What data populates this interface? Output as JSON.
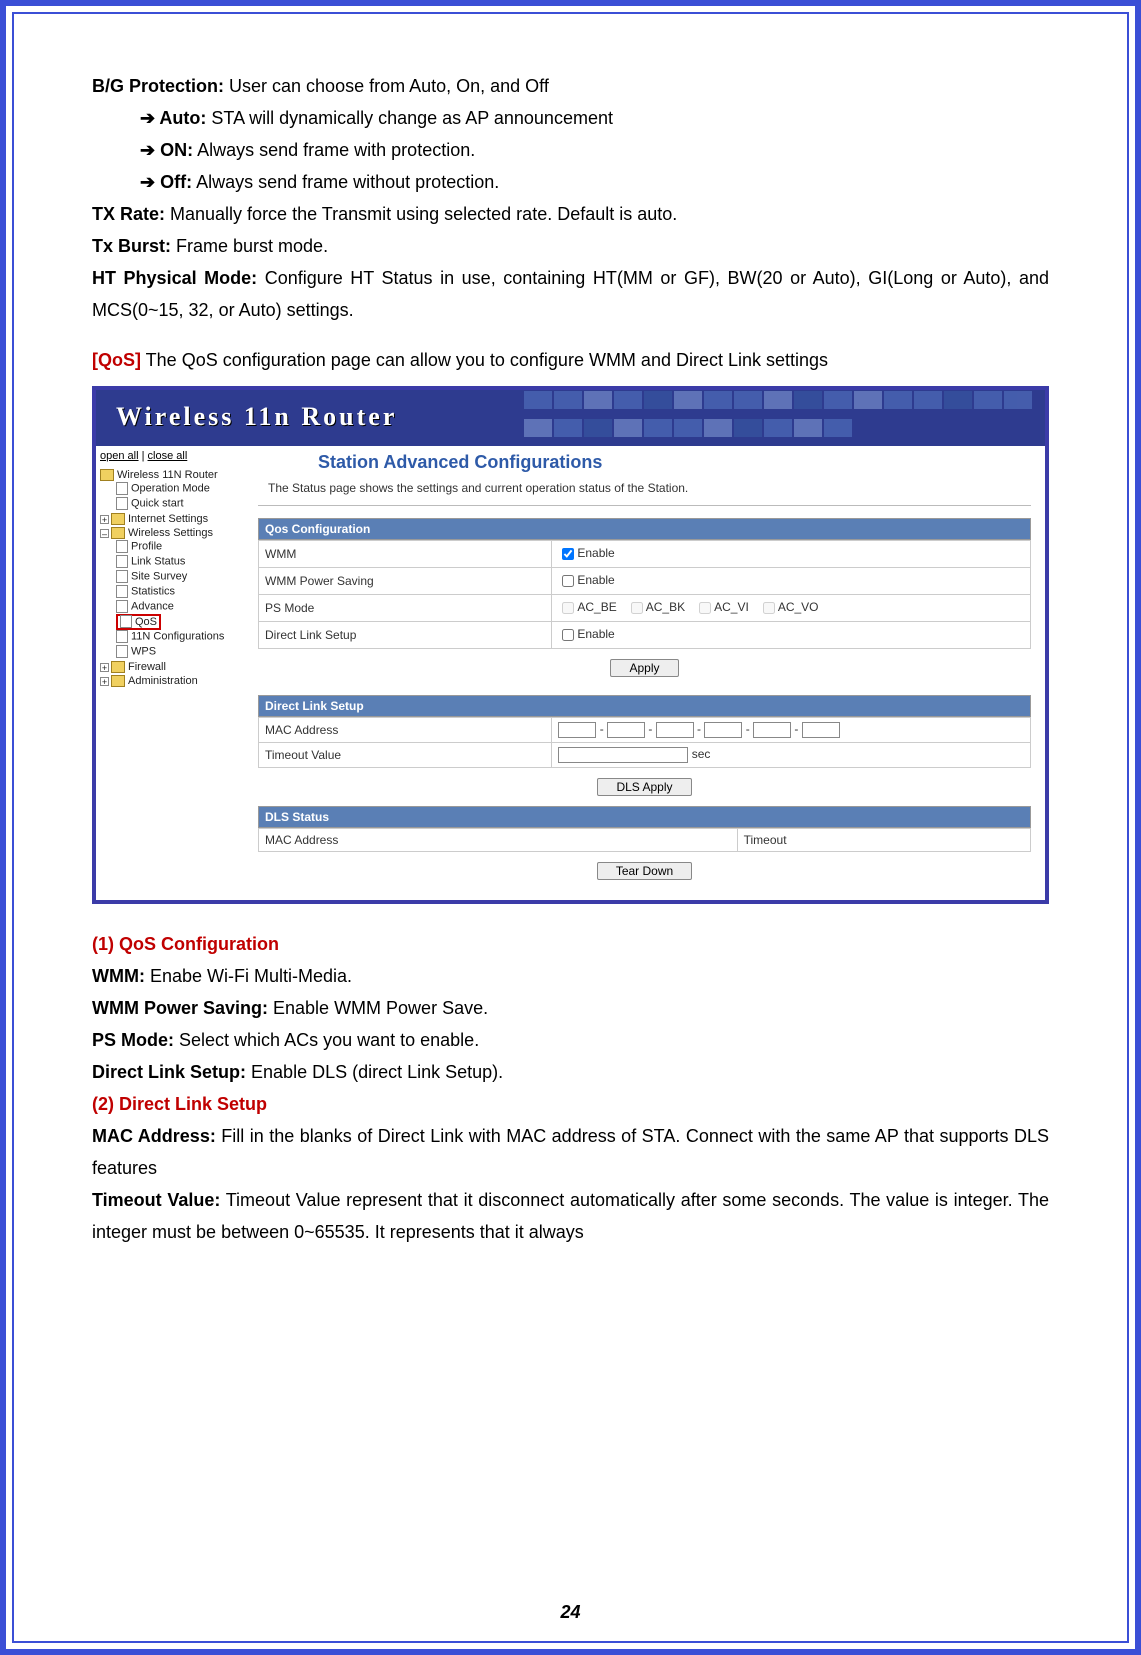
{
  "doc": {
    "bg_protection_label": "B/G Protection:",
    "bg_protection_text": " User can choose from Auto, On, and Off",
    "arrow": "➔",
    "auto_label": " Auto:",
    "auto_text": " STA will dynamically change as AP announcement",
    "on_label": " ON:",
    "on_text": " Always send frame with protection.",
    "off_label": " Off:",
    "off_text": " Always send frame without protection.",
    "txrate_label": "TX Rate:",
    "txrate_text": " Manually force the Transmit using selected rate. Default is auto.",
    "txburst_label": "Tx Burst:",
    "txburst_text": " Frame burst mode.",
    "ht_label": "HT Physical Mode:",
    "ht_text": " Configure HT Status in use, containing HT(MM or GF), BW(20 or Auto), GI(Long or Auto), and MCS(0~15, 32, or Auto) settings.",
    "qos_head": "[QoS]",
    "qos_text": " The QoS configuration page can allow you to configure WMM and Direct Link settings",
    "sec1": "(1) QoS Configuration",
    "wmm_l": "WMM:",
    "wmm_t": " Enabe Wi-Fi Multi-Media.",
    "wps_l": "WMM Power Saving:",
    "wps_t": " Enable WMM Power Save.",
    "ps_l": "PS Mode:",
    "ps_t": " Select which ACs you want to enable.",
    "dls_l": "Direct Link Setup:",
    "dls_t": " Enable DLS (direct Link Setup).",
    "sec2": "(2) Direct Link Setup",
    "mac_l": "MAC Address:",
    "mac_t": " Fill in the blanks of Direct Link with MAC address of STA. Connect with the same AP that supports DLS features",
    "to_l": "Timeout Value:",
    "to_t": " Timeout Value represent that it disconnect automatically after some seconds. The value is integer. The integer must be between 0~65535. It represents that it always",
    "page": "24"
  },
  "shot": {
    "banner": "Wireless 11n Router",
    "open_all": "open all",
    "close_all": "close all",
    "tree": {
      "root": "Wireless 11N Router",
      "op_mode": "Operation Mode",
      "quick": "Quick start",
      "inet": "Internet Settings",
      "wset": "Wireless Settings",
      "profile": "Profile",
      "link": "Link Status",
      "survey": "Site Survey",
      "stats": "Statistics",
      "advance": "Advance",
      "qos": "QoS",
      "n11": "11N Configurations",
      "wps": "WPS",
      "firewall": "Firewall",
      "admin": "Administration"
    },
    "main": {
      "title": "Station Advanced Configurations",
      "desc": "The Status page shows the settings and current operation status of the Station.",
      "qos_panel": "Qos Configuration",
      "r_wmm": "WMM",
      "r_wmmps": "WMM Power Saving",
      "r_ps": "PS Mode",
      "r_dls": "Direct Link Setup",
      "enable": "Enable",
      "ac_be": "AC_BE",
      "ac_bk": "AC_BK",
      "ac_vi": "AC_VI",
      "ac_vo": "AC_VO",
      "apply": "Apply",
      "dls_panel": "Direct Link Setup",
      "mac": "MAC Address",
      "timeout": "Timeout Value",
      "sec": "sec",
      "dls_apply": "DLS Apply",
      "status_panel": "DLS Status",
      "status_mac": "MAC Address",
      "status_to": "Timeout",
      "tear": "Tear Down"
    }
  }
}
